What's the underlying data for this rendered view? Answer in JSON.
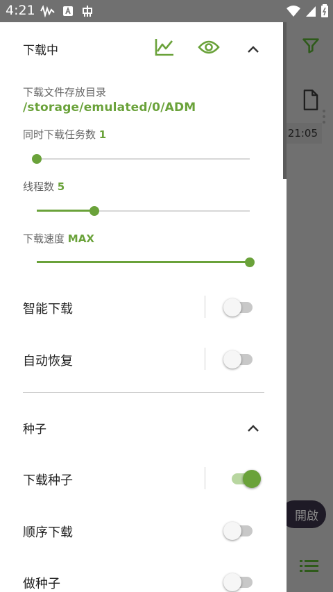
{
  "status_bar": {
    "time": "4:21"
  },
  "background": {
    "time_text": ":21:05",
    "fab_label": "開啟"
  },
  "downloading_section": {
    "title": "下载中",
    "dir_label": "下载文件存放目录",
    "dir_path": "/storage/emulated/0/ADM",
    "concurrent_label": "同时下载任务数",
    "concurrent_value": "1",
    "threads_label": "线程数",
    "threads_value": "5",
    "speed_label": "下载速度",
    "speed_value": "MAX",
    "smart_download_label": "智能下载",
    "auto_resume_label": "自动恢复",
    "sliders": {
      "concurrent_level": 0.0,
      "threads_level": 0.27,
      "speed_level": 1.0
    }
  },
  "torrent_section": {
    "title": "种子",
    "download_torrent_label": "下载种子",
    "sequential_label": "顺序下载",
    "seeding_label": "做种子"
  },
  "toggles": {
    "smart_download": false,
    "auto_resume": false,
    "download_torrent": true,
    "sequential": false,
    "seeding": false
  },
  "colors": {
    "accent": "#6aa23a",
    "scrim": "#707070"
  }
}
